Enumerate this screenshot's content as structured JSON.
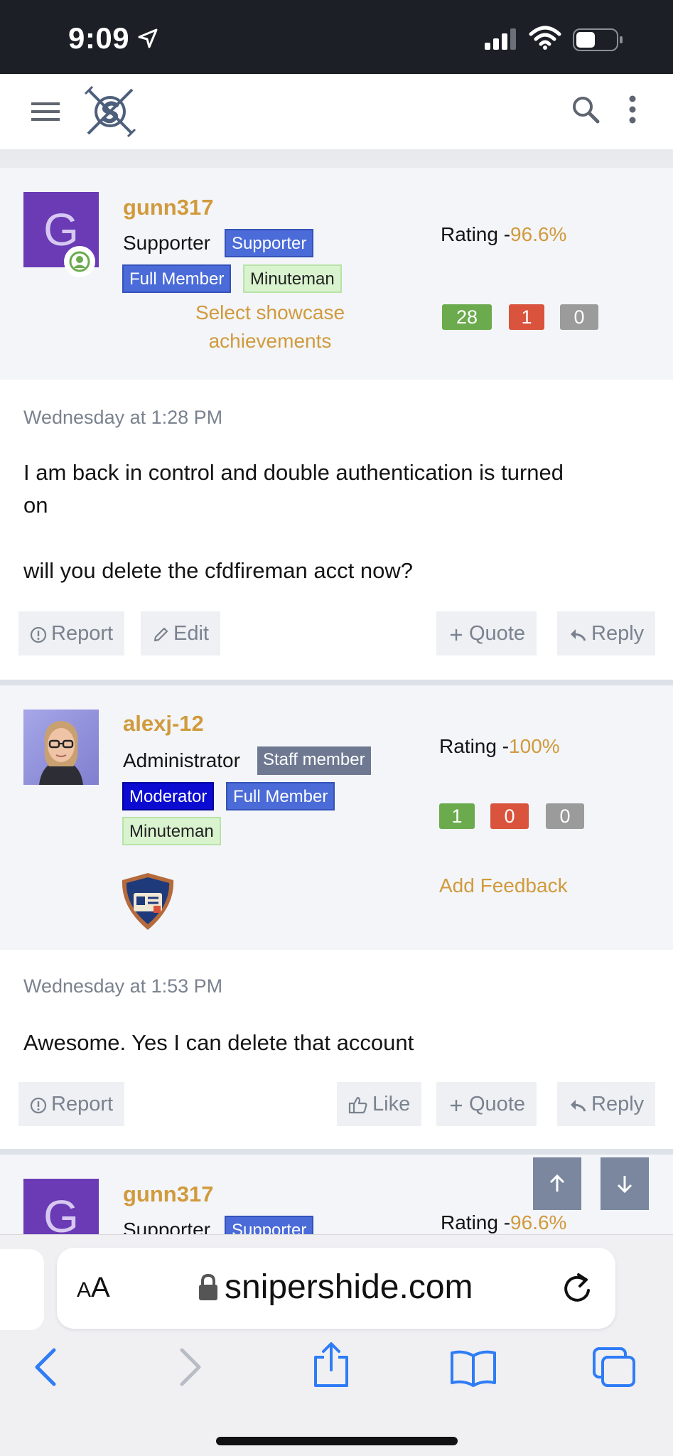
{
  "status_bar": {
    "time": "9:09"
  },
  "app_bar": {
    "logo_alt": "site logo"
  },
  "posts": [
    {
      "username": "gunn317",
      "title": "Supporter",
      "badges": [
        "Supporter",
        "Full Member",
        "Minuteman"
      ],
      "showcase_line1": "Select showcase",
      "showcase_line2": "achievements",
      "rating_label": "Rating -",
      "rating_pct": "96.6%",
      "scores": [
        "28",
        "1",
        "0"
      ],
      "date": "Wednesday at 1:28 PM",
      "text_line1": "I am back in control and double authentication is turned",
      "text_line2": "on",
      "text_line3": "will you delete the cfdfireman acct now?",
      "actions": {
        "report": "Report",
        "edit": "Edit",
        "quote": "Quote",
        "reply": "Reply"
      }
    },
    {
      "username": "alexj-12",
      "title": "Administrator",
      "badges": [
        "Staff member",
        "Moderator",
        "Full Member",
        "Minuteman"
      ],
      "rating_label": "Rating -",
      "rating_pct": "100%",
      "scores": [
        "1",
        "0",
        "0"
      ],
      "feedback": "Add Feedback",
      "date": "Wednesday at 1:53 PM",
      "text_line1": "Awesome. Yes I can delete that account",
      "actions": {
        "report": "Report",
        "like": "Like",
        "quote": "Quote",
        "reply": "Reply"
      }
    },
    {
      "username": "gunn317",
      "title": "Supporter",
      "badges": [
        "Supporter"
      ],
      "rating_label": "Rating -",
      "rating_pct": "96.6%"
    }
  ],
  "browser": {
    "aa_label": "A",
    "aa_small": "A",
    "domain": "snipershide.com"
  },
  "colors": {
    "accent": "#d19a3c",
    "badge_blue": "#4a6bd8",
    "positive": "#6bab4e",
    "negative": "#d9533d",
    "neutral": "#9b9b9b"
  }
}
